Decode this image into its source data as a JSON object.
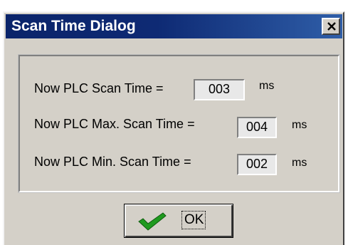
{
  "window": {
    "title": "Scan Time Dialog",
    "close_glyph": "✕",
    "titlebar_color": "#0a246a",
    "face_color": "#d4d0c8"
  },
  "scan_times": [
    {
      "label": "Now PLC Scan Time =",
      "value": "003",
      "unit": "ms"
    },
    {
      "label": "Now PLC Max. Scan Time =",
      "value": "004",
      "unit": "ms"
    },
    {
      "label": "Now PLC Min. Scan Time =",
      "value": "002",
      "unit": "ms"
    }
  ],
  "ok_button": {
    "label": "OK",
    "icon": "green-checkmark-icon",
    "icon_color": "#1f9a1f"
  }
}
